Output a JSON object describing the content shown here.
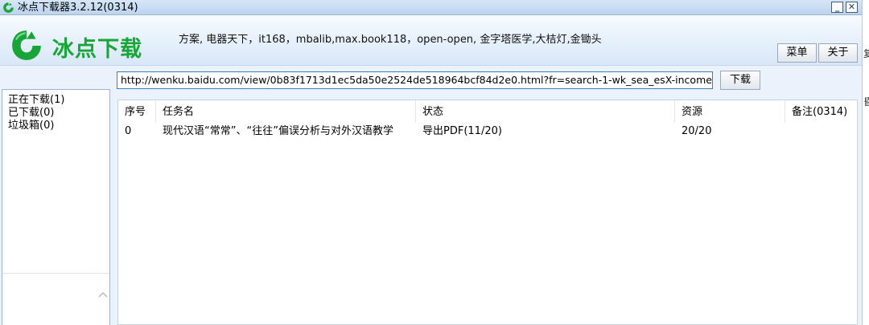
{
  "window": {
    "title": "冰点下载器3.2.12(0314)",
    "minimize_label": "_",
    "close_label": "✕",
    "logo_icon": "bingdian-logo-icon"
  },
  "header": {
    "brand": "冰点下载",
    "supported_sites": "方案, 电器天下，it168，mbalib,max.book118，open-open, 金字塔医学,大桔灯,金锄头",
    "menu_label": "菜单",
    "about_label": "关于",
    "brand_color": "#18a638"
  },
  "url_bar": {
    "value": "http://wenku.baidu.com/view/0b83f1713d1ec5da50e2524de518964bcf84d2e0.html?fr=search-1-wk_sea_esX-income",
    "download_label": "下载"
  },
  "sidebar": {
    "items": [
      {
        "label": "正在下载(1)"
      },
      {
        "label": "已下载(0)"
      },
      {
        "label": "垃圾箱(0)"
      }
    ]
  },
  "tasks": {
    "columns": [
      "序号",
      "任务名",
      "状态",
      "资源",
      "备注(0314)"
    ],
    "rows": [
      {
        "index": "0",
        "name": "现代汉语“常常”、“往往”偏误分析与对外汉语教学",
        "status": "导出PDF(11/20)",
        "resource": "20/20",
        "note": ""
      }
    ]
  },
  "edge_glyphs": [
    "复",
    "昏"
  ]
}
